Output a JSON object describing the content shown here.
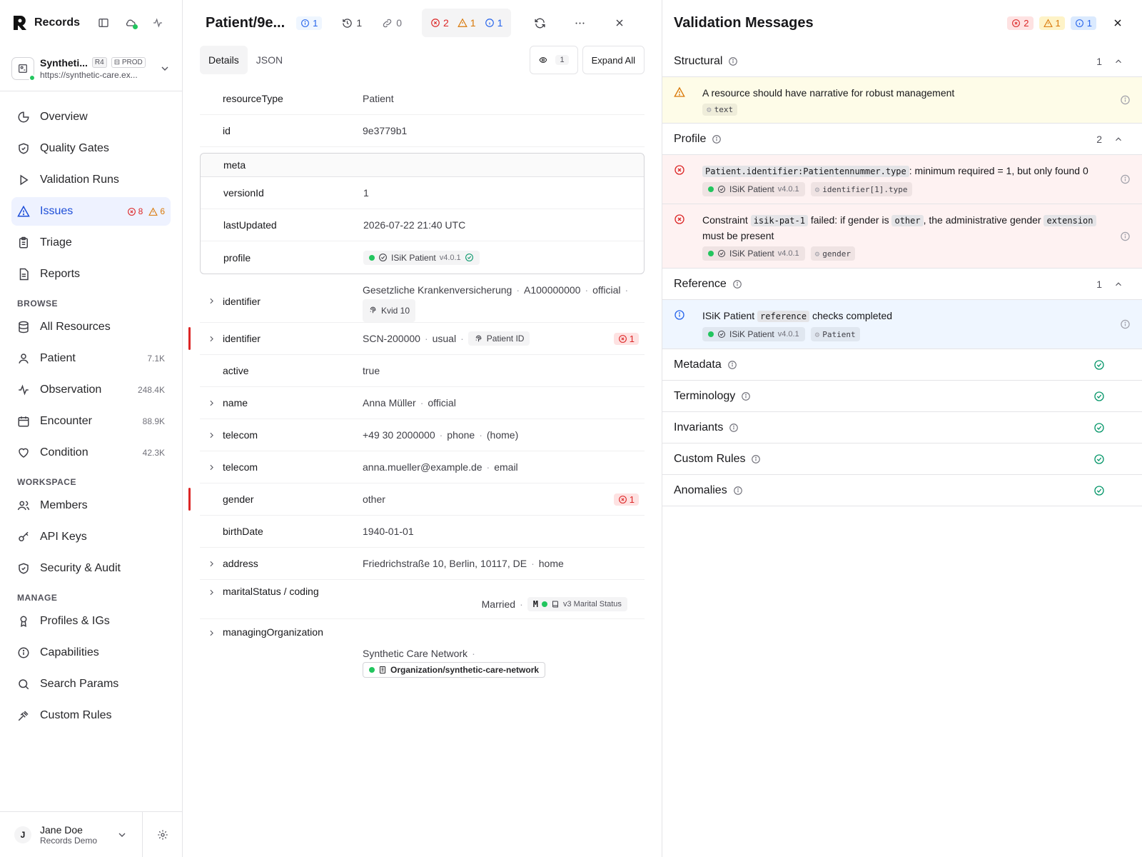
{
  "sidebar": {
    "brand": "Records",
    "env": {
      "name": "Syntheti...",
      "version_tag": "R4",
      "prod_tag": "PROD",
      "url": "https://synthetic-care.ex..."
    },
    "nav": [
      {
        "label": "Overview",
        "icon": "pie-chart-icon"
      },
      {
        "label": "Quality Gates",
        "icon": "shield-check-icon"
      },
      {
        "label": "Validation Runs",
        "icon": "play-icon"
      },
      {
        "label": "Issues",
        "icon": "alert-triangle-icon",
        "errors": "8",
        "warnings": "6"
      },
      {
        "label": "Triage",
        "icon": "clipboard-icon"
      },
      {
        "label": "Reports",
        "icon": "file-text-icon"
      }
    ],
    "browse_label": "BROWSE",
    "browse": [
      {
        "label": "All Resources",
        "icon": "database-icon",
        "count": ""
      },
      {
        "label": "Patient",
        "icon": "user-icon",
        "count": "7.1K"
      },
      {
        "label": "Observation",
        "icon": "activity-icon",
        "count": "248.4K"
      },
      {
        "label": "Encounter",
        "icon": "calendar-icon",
        "count": "88.9K"
      },
      {
        "label": "Condition",
        "icon": "heart-icon",
        "count": "42.3K"
      }
    ],
    "workspace_label": "WORKSPACE",
    "workspace": [
      {
        "label": "Members",
        "icon": "users-icon"
      },
      {
        "label": "API Keys",
        "icon": "key-icon"
      },
      {
        "label": "Security & Audit",
        "icon": "shield-icon"
      }
    ],
    "manage_label": "MANAGE",
    "manage": [
      {
        "label": "Profiles & IGs",
        "icon": "award-icon"
      },
      {
        "label": "Capabilities",
        "icon": "info-icon"
      },
      {
        "label": "Search Params",
        "icon": "search-icon"
      },
      {
        "label": "Custom Rules",
        "icon": "gavel-icon"
      }
    ],
    "user": {
      "initial": "J",
      "name": "Jane Doe",
      "org": "Records Demo"
    }
  },
  "resource": {
    "title": "Patient/9e...",
    "info_count": "1",
    "history_count": "1",
    "links_count": "0",
    "issues": {
      "errors": "2",
      "warnings": "1",
      "info": "1"
    },
    "tabs": [
      "Details",
      "JSON"
    ],
    "eye_count": "1",
    "expand_all": "Expand All",
    "fields": {
      "resourceType": {
        "key": "resourceType",
        "value": "Patient"
      },
      "id": {
        "key": "id",
        "value": "9e3779b1"
      },
      "meta": {
        "key": "meta",
        "versionId": {
          "key": "versionId",
          "value": "1"
        },
        "lastUpdated": {
          "key": "lastUpdated",
          "value": "2026-07-22 21:40 UTC"
        },
        "profile": {
          "key": "profile",
          "name": "ISiK Patient",
          "version": "v4.0.1"
        }
      },
      "identifier1": {
        "key": "identifier",
        "parts": [
          "Gesetzliche Krankenversicherung",
          "A100000000",
          "official"
        ],
        "chip": "Kvid 10"
      },
      "identifier2": {
        "key": "identifier",
        "parts": [
          "SCN-200000",
          "usual"
        ],
        "chip": "Patient ID",
        "errors": "1"
      },
      "active": {
        "key": "active",
        "value": "true"
      },
      "name": {
        "key": "name",
        "parts": [
          "Anna Müller",
          "official"
        ]
      },
      "telecom1": {
        "key": "telecom",
        "parts": [
          "+49 30 2000000",
          "phone",
          "(home)"
        ]
      },
      "telecom2": {
        "key": "telecom",
        "parts": [
          "anna.mueller@example.de",
          "email"
        ]
      },
      "gender": {
        "key": "gender",
        "value": "other",
        "errors": "1"
      },
      "birthDate": {
        "key": "birthDate",
        "value": "1940-01-01"
      },
      "address": {
        "key": "address",
        "parts": [
          "Friedrichstraße 10, Berlin, 10117, DE",
          "home"
        ]
      },
      "maritalStatus": {
        "key": "maritalStatus / coding",
        "display": "Married",
        "code": "M",
        "system": "v3 Marital Status"
      },
      "managingOrganization": {
        "key": "managingOrganization",
        "display": "Synthetic Care Network",
        "reference": "Organization/synthetic-care-network"
      }
    }
  },
  "validation": {
    "title": "Validation Messages",
    "counts": {
      "errors": "2",
      "warnings": "1",
      "info": "1"
    },
    "groups": {
      "structural": {
        "name": "Structural",
        "count": "1",
        "messages": [
          {
            "text": "A resource should have narrative for robust management",
            "path": "text"
          }
        ]
      },
      "profile": {
        "name": "Profile",
        "count": "2",
        "messages": [
          {
            "code": "Patient.identifier:Patientennummer.type",
            "text": ": minimum required = 1, but only found 0",
            "profile": "ISiK Patient",
            "version": "v4.0.1",
            "path": "identifier[1].type"
          },
          {
            "t1": "Constraint ",
            "c1": "isik-pat-1",
            "t2": " failed: if gender is ",
            "c2": "other",
            "t3": ", the administrative gender ",
            "c3": "extension",
            "t4": " must be present",
            "profile": "ISiK Patient",
            "version": "v4.0.1",
            "path": "gender"
          }
        ]
      },
      "reference": {
        "name": "Reference",
        "count": "1",
        "messages": [
          {
            "t1": "ISiK Patient ",
            "c1": "reference",
            "t2": " checks completed",
            "profile": "ISiK Patient",
            "version": "v4.0.1",
            "path": "Patient"
          }
        ]
      },
      "passed": [
        "Metadata",
        "Terminology",
        "Invariants",
        "Custom Rules",
        "Anomalies"
      ]
    }
  },
  "colors": {
    "error": "#dc2626",
    "warning": "#d97706",
    "info": "#2563eb",
    "success": "#059669",
    "accent": "#1d4ed8"
  }
}
